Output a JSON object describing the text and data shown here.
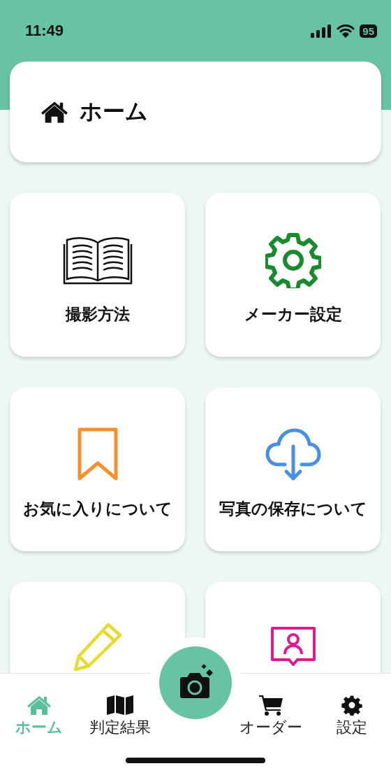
{
  "status_bar": {
    "time": "11:49",
    "battery": "95"
  },
  "header": {
    "title": "ホーム"
  },
  "tiles": [
    {
      "kind": "book",
      "color": "#111111",
      "label": "撮影方法"
    },
    {
      "kind": "gear",
      "color": "#1a8a2e",
      "label": "メーカー設定"
    },
    {
      "kind": "bookmark",
      "color": "#f7902a",
      "label": "お気に入りについて"
    },
    {
      "kind": "cloud",
      "color": "#4a90e2",
      "label": "写真の保存について"
    },
    {
      "kind": "pencil",
      "color": "#e6dc2e"
    },
    {
      "kind": "person",
      "color": "#e0198f"
    }
  ],
  "tab_bar": {
    "items": [
      {
        "kind": "home",
        "label": "ホーム",
        "selected": true
      },
      {
        "kind": "map",
        "label": "判定結果",
        "selected": false
      },
      {
        "kind": "camera",
        "selected": false
      },
      {
        "kind": "cart",
        "label": "オーダー",
        "selected": false
      },
      {
        "kind": "gear",
        "label": "設定",
        "selected": false
      }
    ]
  }
}
